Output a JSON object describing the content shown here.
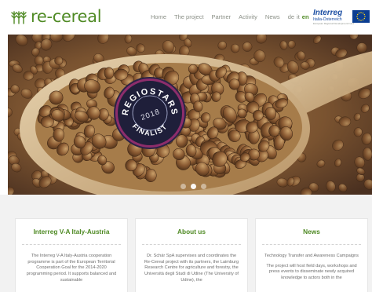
{
  "header": {
    "logo_text": "re-cereal",
    "nav": [
      {
        "label": "Home"
      },
      {
        "label": "The project"
      },
      {
        "label": "Partner"
      },
      {
        "label": "Activity"
      },
      {
        "label": "News"
      }
    ],
    "languages": [
      {
        "label": "de",
        "active": false
      },
      {
        "label": "it",
        "active": false
      },
      {
        "label": "en",
        "active": true
      }
    ],
    "interreg": {
      "name": "Interreg",
      "subtitle": "Italia-Österreich",
      "tagline": "European Regional Development Fund"
    }
  },
  "hero": {
    "badge": {
      "top": "REGIOSTARS",
      "year": "2018",
      "bottom": "FINALIST"
    },
    "slides": 3,
    "active_slide": 1
  },
  "cards": [
    {
      "title": "Interreg V-A Italy-Austria",
      "paragraphs": [
        "The Interreg V-A Italy-Austria cooperation programme is part of the European Territorial Cooperation Goal for the 2014-2020 programming period. It supports balanced and sustainable"
      ]
    },
    {
      "title": "About us",
      "paragraphs": [
        "Dr. Schär SpA supervises and coordinates the Re-Cereal project with its partners, the Laimburg Research Centre for agriculture and forestry, the Università degli Studi di Udine (The University of Udine), the"
      ]
    },
    {
      "title": "News",
      "paragraphs": [
        "Technology Transfer and Awareness Campaigns",
        "The project will host field days, workshops and press events to disseminate newly acquired knowledge to actors both in the"
      ]
    }
  ],
  "colors": {
    "brand_green": "#4f8a24",
    "interreg_blue": "#1d4fa3",
    "badge_purple": "#8d2d6b"
  }
}
